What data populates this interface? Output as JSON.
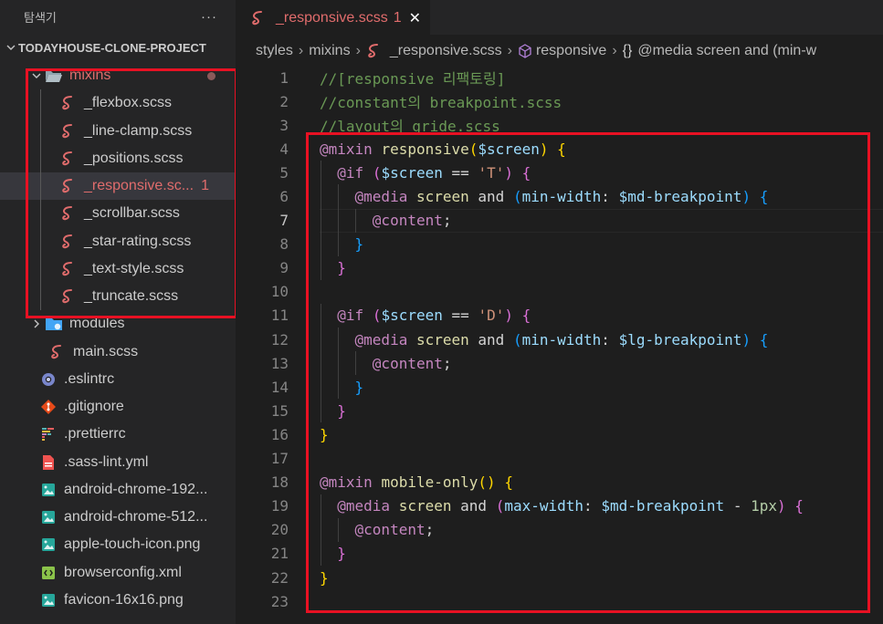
{
  "sidebar": {
    "title": "탐색기",
    "more": "···",
    "project": "TODAYHOUSE-CLONE-PROJECT",
    "mixins_folder": "mixins",
    "mixins_files": [
      {
        "name": "_flexbox.scss"
      },
      {
        "name": "_line-clamp.scss"
      },
      {
        "name": "_positions.scss"
      },
      {
        "name": "_responsive.sc...",
        "badge": "1"
      },
      {
        "name": "_scrollbar.scss"
      },
      {
        "name": "_star-rating.scss"
      },
      {
        "name": "_text-style.scss"
      },
      {
        "name": "_truncate.scss"
      }
    ],
    "modules_folder": "modules",
    "main_file": "main.scss",
    "root_files": [
      {
        "name": ".eslintrc",
        "icon": "eslint-icon"
      },
      {
        "name": ".gitignore",
        "icon": "git-icon"
      },
      {
        "name": ".prettierrc",
        "icon": "prettier-icon"
      },
      {
        "name": ".sass-lint.yml",
        "icon": "yaml-icon"
      },
      {
        "name": "android-chrome-192...",
        "icon": "image-icon"
      },
      {
        "name": "android-chrome-512...",
        "icon": "image-icon"
      },
      {
        "name": "apple-touch-icon.png",
        "icon": "image-icon"
      },
      {
        "name": "browserconfig.xml",
        "icon": "xml-icon"
      },
      {
        "name": "favicon-16x16.png",
        "icon": "image-icon"
      }
    ]
  },
  "tab": {
    "name": "_responsive.scss",
    "badge": "1",
    "close": "✕"
  },
  "breadcrumbs": {
    "styles": "styles",
    "mixins": "mixins",
    "file": "_responsive.scss",
    "symbol": "responsive",
    "media": "@media screen and (min-w"
  },
  "code": {
    "active_line": 7,
    "lines": [
      "//[responsive 리팩토링]",
      "//constant의 breakpoint.scss",
      "//layout의 gride.scss",
      "@mixin responsive($screen) {",
      "  @if ($screen == 'T') {",
      "    @media screen and (min-width: $md-breakpoint) {",
      "      @content;",
      "    }",
      "  }",
      "",
      "  @if ($screen == 'D') {",
      "    @media screen and (min-width: $lg-breakpoint) {",
      "      @content;",
      "    }",
      "  }",
      "}",
      "",
      "@mixin mobile-only() {",
      "  @media screen and (max-width: $md-breakpoint - 1px) {",
      "    @content;",
      "  }",
      "}",
      ""
    ]
  },
  "colors": {
    "highlight_box": "#e81123",
    "sass_icon": "#e06c6c"
  }
}
